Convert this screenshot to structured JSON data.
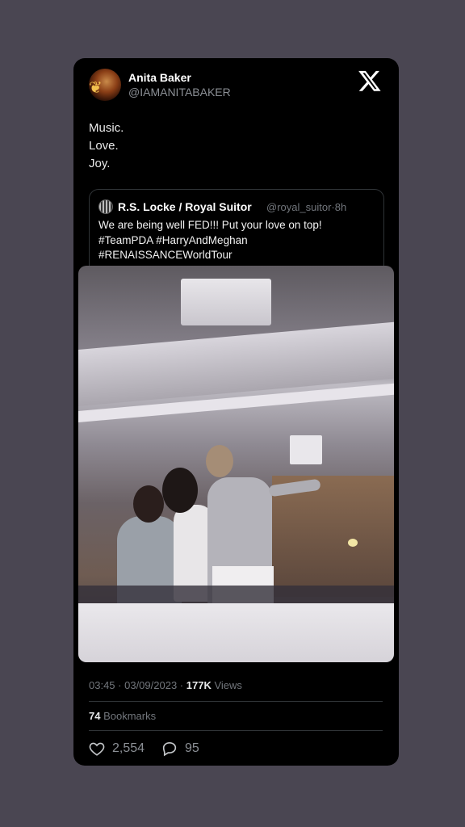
{
  "tweet": {
    "author_name": "Anita Baker",
    "author_handle": "@IAMANITABAKER",
    "body_lines": [
      "Music.",
      "Love.",
      "Joy."
    ]
  },
  "quoted_tweet": {
    "author_name": "R.S. Locke / Royal Suitor",
    "author_handle": "@royal_suitor",
    "time": "8h",
    "text_lines": [
      "We are being well FED!!! Put your love on top!",
      "#TeamPDA #HarryAndMeghan",
      "#RENAISSANCEWorldTour"
    ]
  },
  "meta": {
    "time": "03:45",
    "date": "03/09/2023",
    "views_count": "177K",
    "views_label": "Views"
  },
  "bookmarks": {
    "count": "74",
    "label": "Bookmarks"
  },
  "actions": {
    "likes": "2,554",
    "replies": "95"
  },
  "icons": {
    "brand": "x-logo-icon",
    "like": "heart-icon",
    "reply": "comment-icon"
  },
  "colors": {
    "background": "#4a4652",
    "card": "#000000",
    "secondary_text": "#72767c"
  }
}
